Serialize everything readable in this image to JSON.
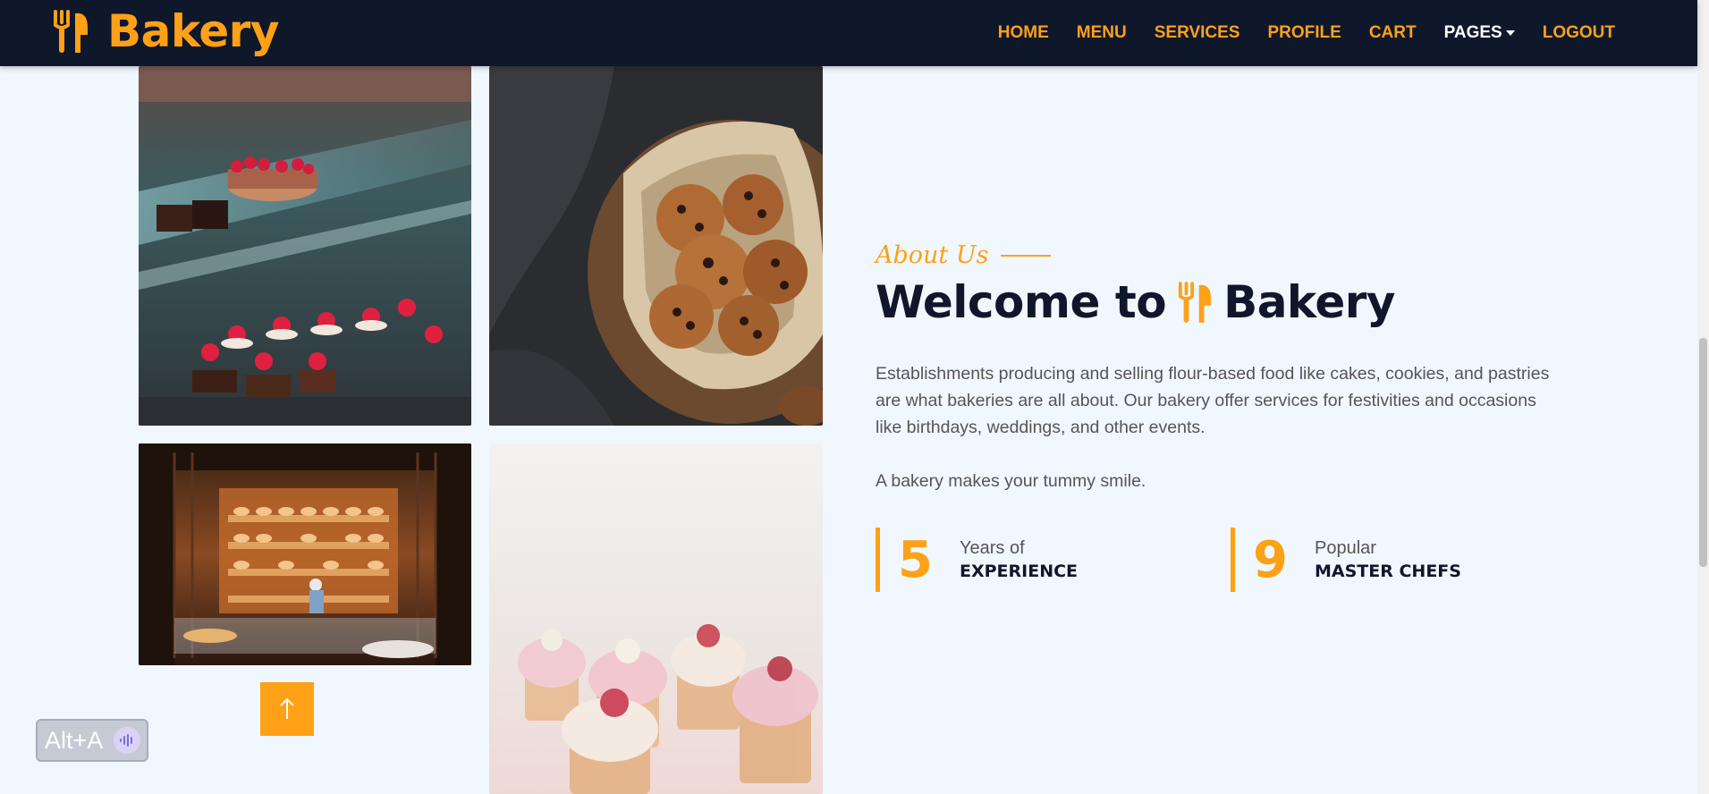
{
  "brand": {
    "name": "Bakery",
    "icon": "utensils-icon"
  },
  "nav": {
    "items": [
      {
        "label": "HOME"
      },
      {
        "label": "MENU"
      },
      {
        "label": "SERVICES"
      },
      {
        "label": "PROFILE"
      },
      {
        "label": "CART"
      },
      {
        "label": "PAGES",
        "dropdown": true
      },
      {
        "label": "LOGOUT"
      }
    ]
  },
  "images": [
    {
      "name": "pastry-display-case-photo"
    },
    {
      "name": "chocolate-chip-cookies-photo"
    },
    {
      "name": "bakery-shop-interior-photo"
    },
    {
      "name": "strawberry-cupcakes-photo"
    }
  ],
  "about": {
    "tag": "About Us",
    "title_prefix": "Welcome to",
    "title_brand": "Bakery",
    "paragraph1": "Establishments producing and selling flour-based food like cakes, cookies, and pastries are what bakeries are all about. Our bakery offer services for festivities and occasions like birthdays, weddings, and other events.",
    "paragraph2": "A bakery makes your tummy smile.",
    "stats": [
      {
        "number": "5",
        "label": "Years of",
        "value": "EXPERIENCE"
      },
      {
        "number": "9",
        "label": "Popular",
        "value": "MASTER CHEFS"
      }
    ]
  },
  "back_to_top": {
    "icon": "arrow-up-icon"
  },
  "shortcut_widget": {
    "label": "Alt+A",
    "icon": "audio-wave-icon"
  },
  "colors": {
    "accent": "#fea116",
    "navbar": "#0f172b",
    "background": "#f1f7fe",
    "heading": "#0f172b"
  }
}
